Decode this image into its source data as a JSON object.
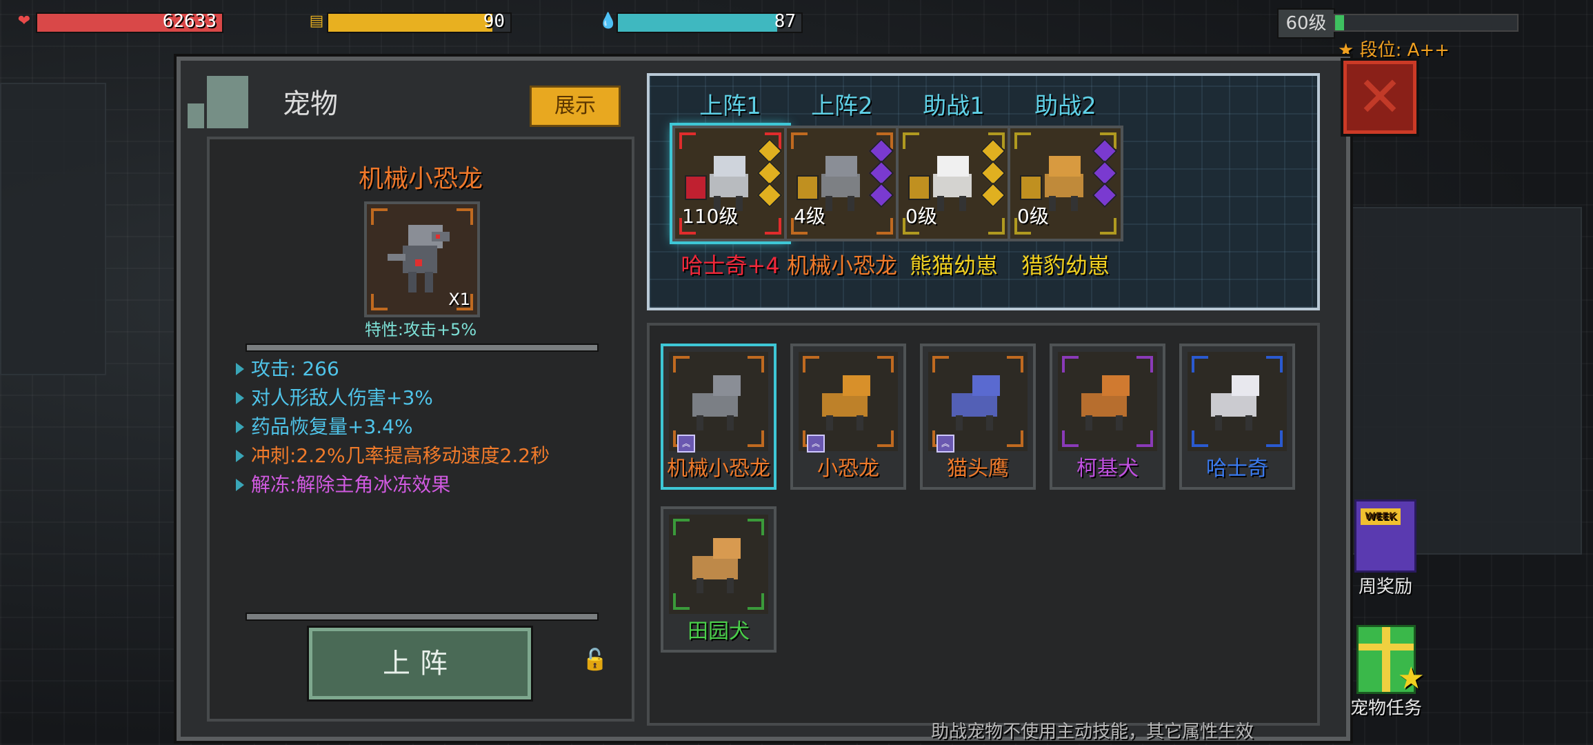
{
  "hud": {
    "hp_value": "62633",
    "hp_fraction": 1.0,
    "energy_value": "90",
    "energy_fraction": 0.9,
    "mana_value": "87",
    "mana_fraction": 0.87,
    "level_badge": "60级",
    "xp_fraction": 0.05,
    "rank_text": "段位: A++"
  },
  "panel": {
    "title": "宠物",
    "show_label": "展示",
    "close_label": "✕"
  },
  "detail": {
    "name": "机械小恐龙",
    "count": "X1",
    "trait": "特性:攻击+5%",
    "stats": [
      {
        "text": "攻击: 266",
        "color": "#4fc3e8"
      },
      {
        "text": "对人形敌人伤害+3%",
        "color": "#4fc3e8"
      },
      {
        "text": "药品恢复量+3.4%",
        "color": "#4fc3e8"
      },
      {
        "text": "冲刺:2.2%几率提高移动速度2.2秒",
        "color": "#f07a2a"
      },
      {
        "text": "解冻:解除主角冰冻效果",
        "color": "#d05ae0"
      }
    ],
    "deploy_label": "上阵"
  },
  "team": {
    "slots": [
      {
        "label": "上阵1",
        "level": "110级",
        "name": "哈士奇+4",
        "name_color": "#f0283a",
        "frame": "#e02c2c",
        "selected": true
      },
      {
        "label": "上阵2",
        "level": "4级",
        "name": "机械小恐龙",
        "name_color": "#f07a2a",
        "frame": "#c06a20",
        "selected": false
      },
      {
        "label": "助战1",
        "level": "0级",
        "name": "熊猫幼崽",
        "name_color": "#f0d020",
        "frame": "#b09a20",
        "selected": false
      },
      {
        "label": "助战2",
        "level": "0级",
        "name": "猎豹幼崽",
        "name_color": "#f0d020",
        "frame": "#b09a20",
        "selected": false
      }
    ]
  },
  "pets": [
    {
      "name": "机械小恐龙",
      "color": "#f07a2a",
      "frame": "#c06a20",
      "selected": true,
      "ranked": true
    },
    {
      "name": "小恐龙",
      "color": "#f07a2a",
      "frame": "#c06a20",
      "selected": false,
      "ranked": true
    },
    {
      "name": "猫头鹰",
      "color": "#f07a2a",
      "frame": "#c06a20",
      "selected": false,
      "ranked": true
    },
    {
      "name": "柯基犬",
      "color": "#c050e0",
      "frame": "#8a3ab8",
      "selected": false,
      "ranked": false
    },
    {
      "name": "哈士奇",
      "color": "#3a7af0",
      "frame": "#2a5ad0",
      "selected": false,
      "ranked": false
    },
    {
      "name": "田园犬",
      "color": "#4ad04a",
      "frame": "#3a9a3a",
      "selected": false,
      "ranked": false
    }
  ],
  "footer_note": "助战宠物不使用主动技能，其它属性生效",
  "side_buttons": {
    "weekly_label": "周奖励",
    "weekly_art_text": "WEEK",
    "task_label": "宠物任务"
  },
  "colors": {
    "accent": "#3ec7d6",
    "hp": "#d94848",
    "energy": "#e8b020",
    "mana": "#3fb8c0"
  }
}
